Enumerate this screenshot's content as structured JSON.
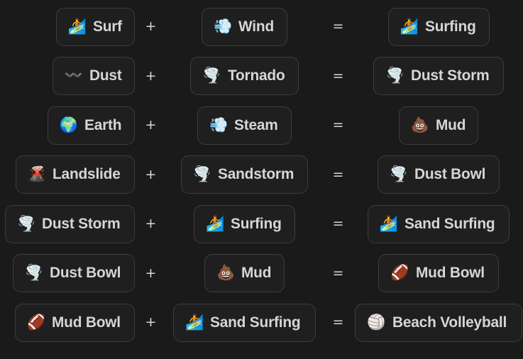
{
  "app": {
    "title": "Crafting Recipes",
    "background_color": "#1a1a1a",
    "card_background_color": "#1f1f1f",
    "card_border_color": "#3d3d3d",
    "text_color": "#d6d6da",
    "operator_color": "#d8d8d8"
  },
  "operators": {
    "plus": "+",
    "equals": "="
  },
  "recipes": [
    {
      "a": {
        "emoji": "🏄",
        "icon_name": "surfer-emoji",
        "label": "Surf"
      },
      "b": {
        "emoji": "💨",
        "icon_name": "dashing-away-emoji",
        "label": "Wind"
      },
      "result": {
        "emoji": "🏄",
        "icon_name": "surfer-emoji",
        "label": "Surfing"
      }
    },
    {
      "a": {
        "emoji": "〰️",
        "icon_name": "wavy-dash-emoji",
        "label": "Dust"
      },
      "b": {
        "emoji": "🌪️",
        "icon_name": "tornado-emoji",
        "label": "Tornado"
      },
      "result": {
        "emoji": "🌪️",
        "icon_name": "tornado-emoji",
        "label": "Dust Storm"
      }
    },
    {
      "a": {
        "emoji": "🌍",
        "icon_name": "earth-globe-emoji",
        "label": "Earth"
      },
      "b": {
        "emoji": "💨",
        "icon_name": "dashing-away-emoji",
        "label": "Steam"
      },
      "result": {
        "emoji": "💩",
        "icon_name": "pile-of-poo-emoji",
        "label": "Mud"
      }
    },
    {
      "a": {
        "emoji": "🌋",
        "icon_name": "volcano-emoji",
        "label": "Landslide"
      },
      "b": {
        "emoji": "🌪️",
        "icon_name": "tornado-emoji",
        "label": "Sandstorm"
      },
      "result": {
        "emoji": "🌪️",
        "icon_name": "tornado-emoji",
        "label": "Dust Bowl"
      }
    },
    {
      "a": {
        "emoji": "🌪️",
        "icon_name": "tornado-emoji",
        "label": "Dust Storm"
      },
      "b": {
        "emoji": "🏄",
        "icon_name": "surfer-emoji",
        "label": "Surfing"
      },
      "result": {
        "emoji": "🏄",
        "icon_name": "surfer-emoji",
        "label": "Sand Surfing"
      }
    },
    {
      "a": {
        "emoji": "🌪️",
        "icon_name": "tornado-emoji",
        "label": "Dust Bowl"
      },
      "b": {
        "emoji": "💩",
        "icon_name": "pile-of-poo-emoji",
        "label": "Mud"
      },
      "result": {
        "emoji": "🏈",
        "icon_name": "american-football-emoji",
        "label": "Mud Bowl"
      }
    },
    {
      "a": {
        "emoji": "🏈",
        "icon_name": "american-football-emoji",
        "label": "Mud Bowl"
      },
      "b": {
        "emoji": "🏄",
        "icon_name": "surfer-emoji",
        "label": "Sand Surfing"
      },
      "result": {
        "emoji": "🏐",
        "icon_name": "volleyball-emoji",
        "label": "Beach Volleyball"
      }
    }
  ]
}
